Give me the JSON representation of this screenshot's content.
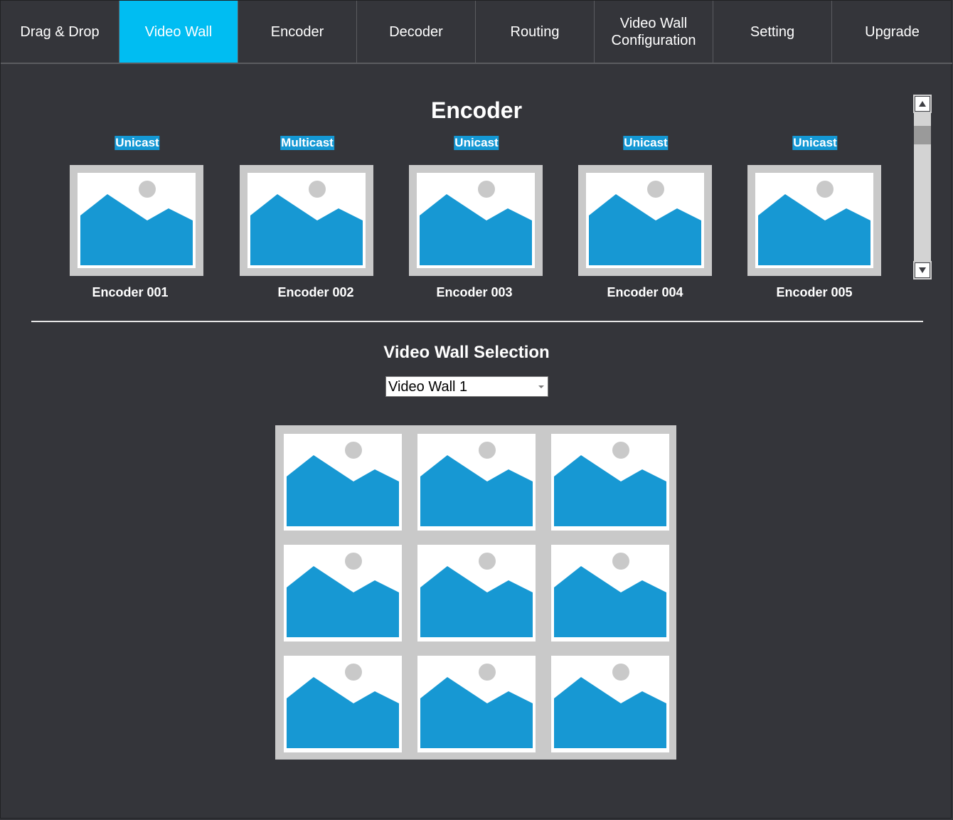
{
  "nav": {
    "tabs": [
      {
        "label": "Drag & Drop",
        "active": false
      },
      {
        "label": "Video Wall",
        "active": true
      },
      {
        "label": "Encoder",
        "active": false
      },
      {
        "label": "Decoder",
        "active": false
      },
      {
        "label": "Routing",
        "active": false
      },
      {
        "label": "Video Wall\nConfiguration",
        "active": false
      },
      {
        "label": "Setting",
        "active": false
      },
      {
        "label": "Upgrade",
        "active": false
      }
    ]
  },
  "encoder_section": {
    "title": "Encoder",
    "encoders": [
      {
        "cast": "Unicast",
        "name": "Encoder 001"
      },
      {
        "cast": "Multicast",
        "name": "Encoder 002"
      },
      {
        "cast": "Unicast",
        "name": "Encoder 003"
      },
      {
        "cast": "Unicast",
        "name": "Encoder 004"
      },
      {
        "cast": "Unicast",
        "name": "Encoder 005"
      }
    ]
  },
  "video_wall": {
    "title": "Video Wall Selection",
    "selected": "Video Wall 1",
    "grid": {
      "rows": 3,
      "cols": 3
    }
  },
  "icons": {
    "scroll_up": "arrow-up-icon",
    "scroll_down": "arrow-down-icon",
    "thumbnail": "image-placeholder-icon",
    "dropdown": "chevron-down-icon"
  },
  "colors": {
    "background": "#34353a",
    "active_tab": "#00bdf2",
    "badge": "#1498d4",
    "mountain": "#1798d3",
    "frame": "#c9c9c9"
  }
}
